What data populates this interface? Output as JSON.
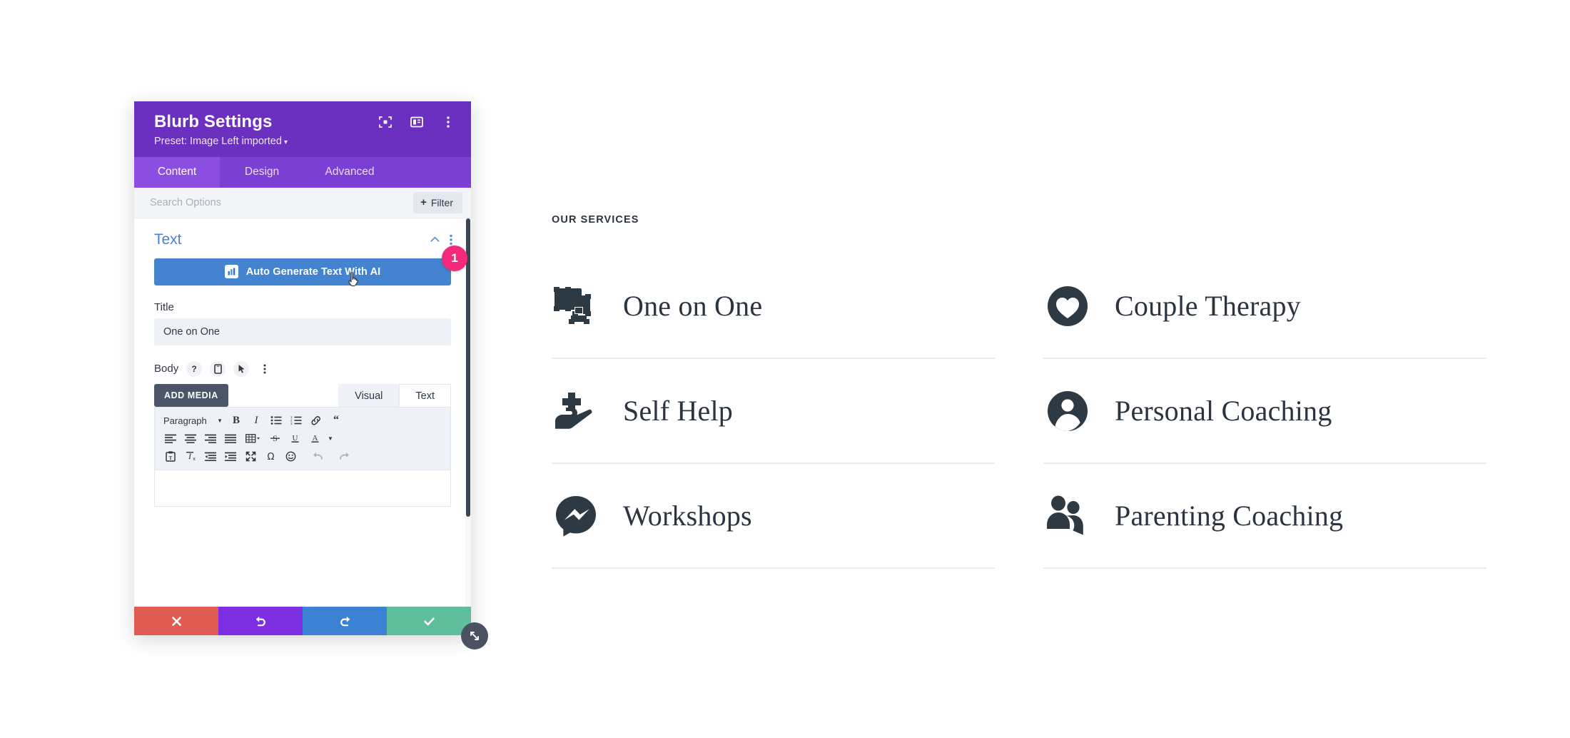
{
  "panel": {
    "title": "Blurb Settings",
    "preset": "Preset: Image Left imported",
    "preset_caret": "▾",
    "header_icons": [
      {
        "name": "focus-icon",
        "label": "Focus"
      },
      {
        "name": "layout-panel-icon",
        "label": "Layout"
      },
      {
        "name": "more-options-icon",
        "label": "More"
      }
    ],
    "tabs": [
      {
        "label": "Content",
        "active": true
      },
      {
        "label": "Design",
        "active": false
      },
      {
        "label": "Advanced",
        "active": false
      }
    ],
    "search": {
      "placeholder": "Search Options",
      "value": ""
    },
    "filter_button": {
      "plus": "+",
      "label": "Filter"
    },
    "section": {
      "title": "Text",
      "collapse_icon": "chevron-up",
      "menu_icon": "kebab"
    },
    "ai_button": {
      "label": "Auto Generate Text With AI",
      "icon_label": "AI"
    },
    "step_badge": "1",
    "title_field": {
      "label": "Title",
      "value": "One on One",
      "placeholder": ""
    },
    "body_field": {
      "label": "Body",
      "mini_icons": [
        "help-icon",
        "mobile-icon",
        "cursor-icon",
        "kebab-icon"
      ]
    },
    "editor": {
      "add_media": "ADD MEDIA",
      "tabs": [
        {
          "label": "Visual",
          "active": true
        },
        {
          "label": "Text",
          "active": false
        }
      ],
      "format_select": "Paragraph",
      "toolbar_row1": [
        "bold-icon",
        "italic-icon",
        "bulleted-list-icon",
        "numbered-list-icon",
        "link-icon",
        "blockquote-icon"
      ],
      "toolbar_row2": [
        "align-left-icon",
        "align-center-icon",
        "align-right-icon",
        "align-justify-icon",
        "table-icon",
        "strikethrough-icon",
        "underline-icon",
        "text-color-icon"
      ],
      "toolbar_row3": [
        "paste-as-text-icon",
        "clear-formatting-icon",
        "outdent-icon",
        "indent-icon",
        "fullscreen-icon",
        "special-character-icon",
        "emoji-icon",
        "undo-icon",
        "redo-icon"
      ],
      "content": ""
    },
    "footer_buttons": [
      {
        "name": "cancel-button",
        "icon": "close-x",
        "color": "#e05c53"
      },
      {
        "name": "undo-button",
        "icon": "undo-arrow",
        "color": "#7b2fe0"
      },
      {
        "name": "redo-button",
        "icon": "redo-arrow",
        "color": "#3b82d4"
      },
      {
        "name": "save-button",
        "icon": "checkmark",
        "color": "#5fbf9c"
      }
    ],
    "resize_handle": "resize-diagonal-icon"
  },
  "services": {
    "eyebrow": "OUR SERVICES",
    "left_column": [
      {
        "label": "One on One",
        "icon": "film-clapper-icon"
      },
      {
        "label": "Self Help",
        "icon": "hand-plus-icon"
      },
      {
        "label": "Workshops",
        "icon": "messenger-chat-icon"
      }
    ],
    "right_column": [
      {
        "label": "Couple Therapy",
        "icon": "heart-circle-icon"
      },
      {
        "label": "Personal Coaching",
        "icon": "person-circle-icon"
      },
      {
        "label": "Parenting Coaching",
        "icon": "two-people-icon"
      }
    ]
  },
  "colors": {
    "panel_header": "#6b30bf",
    "tab_bar": "#7b3fd4",
    "tab_active": "#8b4ee0",
    "ai_button": "#4383cf",
    "badge": "#f4297c",
    "icon_dark": "#2d3943"
  }
}
